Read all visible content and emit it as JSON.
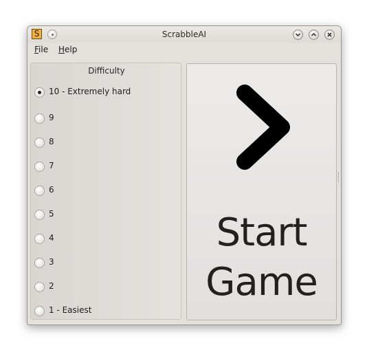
{
  "window": {
    "title": "ScrabbleAI",
    "app_icon_letter": "S"
  },
  "menu": {
    "file_letter": "F",
    "file_rest": "ile",
    "help_letter": "H",
    "help_rest": "elp"
  },
  "difficulty": {
    "heading": "Difficulty",
    "options": [
      {
        "label": "10 - Extremely hard",
        "checked": true
      },
      {
        "label": "9",
        "checked": false
      },
      {
        "label": "8",
        "checked": false
      },
      {
        "label": "7",
        "checked": false
      },
      {
        "label": "6",
        "checked": false
      },
      {
        "label": "5",
        "checked": false
      },
      {
        "label": "4",
        "checked": false
      },
      {
        "label": "3",
        "checked": false
      },
      {
        "label": "2",
        "checked": false
      },
      {
        "label": "1 - Easiest",
        "checked": false
      }
    ]
  },
  "start_button": {
    "line1": "Start",
    "line2": "Game",
    "icon": "chevron-right-icon"
  },
  "colors": {
    "window_bg": "#e4e1dd",
    "text": "#232120",
    "app_icon_bg": "#f1b23d"
  }
}
